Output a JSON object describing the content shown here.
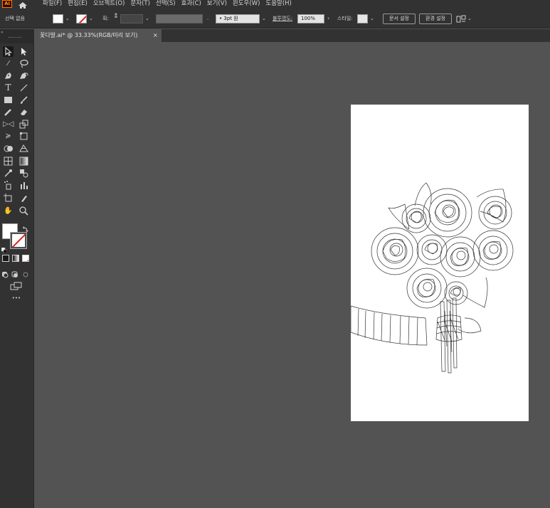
{
  "app": {
    "logo_text": "Ai"
  },
  "menu": [
    "파일(F)",
    "편집(E)",
    "오브젝트(O)",
    "문자(T)",
    "선택(S)",
    "효과(C)",
    "보기(V)",
    "윈도우(W)",
    "도움말(H)"
  ],
  "control_bar": {
    "selection_label": "선택 없음",
    "stroke_weight_label": "획:",
    "brush_value": "3pt 원",
    "opacity_label": "불투명도:",
    "opacity_value": "100%",
    "style_label": "스타일:",
    "doc_setup_label": "문서 설정",
    "preferences_label": "환경 설정"
  },
  "document_tab": {
    "title": "꽃다발.ai* @ 33.33%(RGB/미리 보기)",
    "close_symbol": "×"
  },
  "toolbar": {
    "more_label": "•••"
  },
  "colors": {
    "fill": "#ffffff",
    "stroke_none_slash": "#e02020",
    "interface_dark": "#323232",
    "canvas": "#535353"
  },
  "icons": [
    "home-icon",
    "selection-tool-icon",
    "direct-selection-tool-icon",
    "magic-wand-icon",
    "lasso-icon",
    "pen-tool-icon",
    "curvature-tool-icon",
    "type-tool-icon",
    "line-tool-icon",
    "rectangle-tool-icon",
    "paintbrush-icon",
    "shaper-icon",
    "eraser-icon",
    "rotate-icon",
    "scale-icon",
    "width-tool-icon",
    "free-transform-icon",
    "shape-builder-icon",
    "perspective-grid-icon",
    "mesh-tool-icon",
    "gradient-tool-icon",
    "eyedropper-icon",
    "blend-tool-icon",
    "symbol-sprayer-icon",
    "column-graph-icon",
    "artboard-tool-icon",
    "slice-tool-icon",
    "hand-tool-icon",
    "zoom-tool-icon"
  ]
}
